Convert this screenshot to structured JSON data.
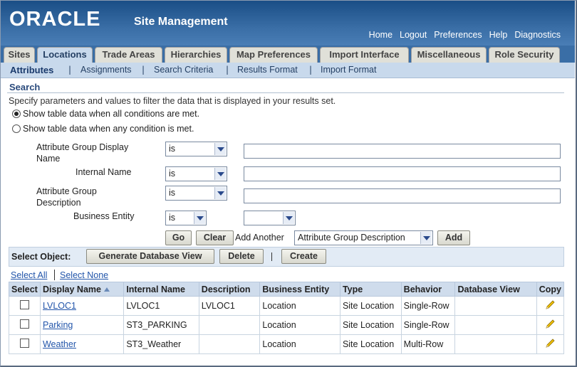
{
  "branding": {
    "logo": "ORACLE",
    "app_title": "Site Management"
  },
  "global_links": [
    "Home",
    "Logout",
    "Preferences",
    "Help",
    "Diagnostics"
  ],
  "tabs": [
    "Sites",
    "Locations",
    "Trade Areas",
    "Hierarchies",
    "Map Preferences",
    "Import Interface",
    "Miscellaneous",
    "Role Security"
  ],
  "active_tab": "Locations",
  "subtabs": [
    "Attributes",
    "Assignments",
    "Search Criteria",
    "Results Format",
    "Import Format"
  ],
  "search": {
    "title": "Search",
    "instruction": "Specify parameters and values to filter the data that is displayed in your results set.",
    "radio_all": "Show table data when all conditions are met.",
    "radio_any": "Show table data when any condition is met.",
    "selected_radio": "all",
    "rows": [
      {
        "label": "Attribute Group Display Name",
        "operator": "is",
        "value": ""
      },
      {
        "label": "Internal Name",
        "operator": "is",
        "value": ""
      },
      {
        "label": "Attribute Group Description",
        "operator": "is",
        "value": ""
      },
      {
        "label": "Business Entity",
        "operator": "is",
        "value": ""
      }
    ],
    "go_label": "Go",
    "clear_label": "Clear",
    "add_another_label": "Add Another",
    "add_another_value": "Attribute Group Description",
    "add_label": "Add"
  },
  "toolbar": {
    "select_object_label": "Select Object:",
    "generate_label": "Generate Database View",
    "delete_label": "Delete",
    "create_label": "Create"
  },
  "select_all": "Select All",
  "select_none": "Select None",
  "table": {
    "columns": [
      "Select",
      "Display Name",
      "Internal Name",
      "Description",
      "Business Entity",
      "Type",
      "Behavior",
      "Database View",
      "Copy"
    ],
    "rows": [
      {
        "display_name": "LVLOC1",
        "internal_name": "LVLOC1",
        "description": "LVLOC1",
        "business_entity": "Location",
        "type": "Site Location",
        "behavior": "Single-Row",
        "database_view": ""
      },
      {
        "display_name": "Parking",
        "internal_name": "ST3_PARKING",
        "description": "",
        "business_entity": "Location",
        "type": "Site Location",
        "behavior": "Single-Row",
        "database_view": ""
      },
      {
        "display_name": "Weather",
        "internal_name": "ST3_Weather",
        "description": "",
        "business_entity": "Location",
        "type": "Site Location",
        "behavior": "Multi-Row",
        "database_view": ""
      }
    ]
  },
  "icons": {
    "sort": "sort-ascending-icon",
    "copy": "pencil-icon",
    "dropdown": "chevron-down-icon"
  },
  "colors": {
    "header_blue": "#1a4e86",
    "tab_active": "#c8d9ec",
    "link": "#2255aa"
  }
}
